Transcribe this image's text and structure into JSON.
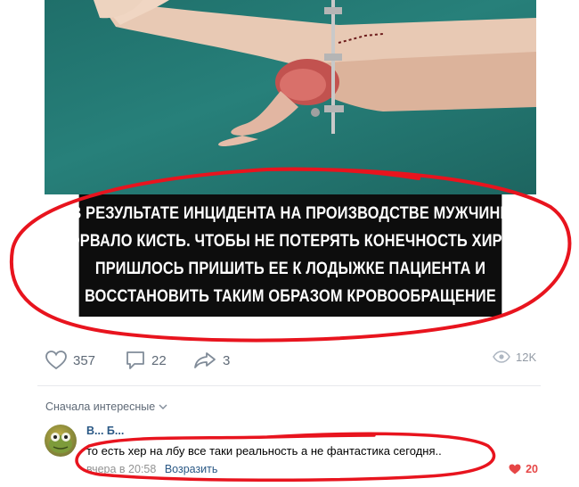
{
  "post": {
    "caption_lines": [
      "В РЕЗУЛЬТАТЕ ИНЦИДЕНТА НА ПРОИЗВОДСТВЕ МУЖЧИНЕ",
      "ОТОРВАЛО КИСТЬ. ЧТОБЫ НЕ ПОТЕРЯТЬ КОНЕЧНОСТЬ ХИРУРГАМ",
      "ПРИШЛОСЬ ПРИШИТЬ ЕЕ К ЛОДЫЖКЕ ПАЦИЕНТА И",
      "ВОССТАНОВИТЬ ТАКИМ ОБРАЗОМ КРОВООБРАЩЕНИЕ"
    ]
  },
  "actions": {
    "likes": "357",
    "comments": "22",
    "shares": "3",
    "views": "12K",
    "icons": [
      "heart-icon",
      "comment-icon",
      "share-icon",
      "eye-icon"
    ]
  },
  "comments_section": {
    "sort_label": "Сначала интересные",
    "comment": {
      "author": "В... Б...",
      "text": "то есть хер на лбу все таки реальность а не фантастика сегодня..",
      "time": "вчера в 20:58",
      "reply_label": "Возразить",
      "likes": "20"
    }
  },
  "colors": {
    "link": "#2a5885",
    "icon_gray": "#818c99",
    "like_red": "#e64646",
    "annotation_red": "#e8141e"
  }
}
